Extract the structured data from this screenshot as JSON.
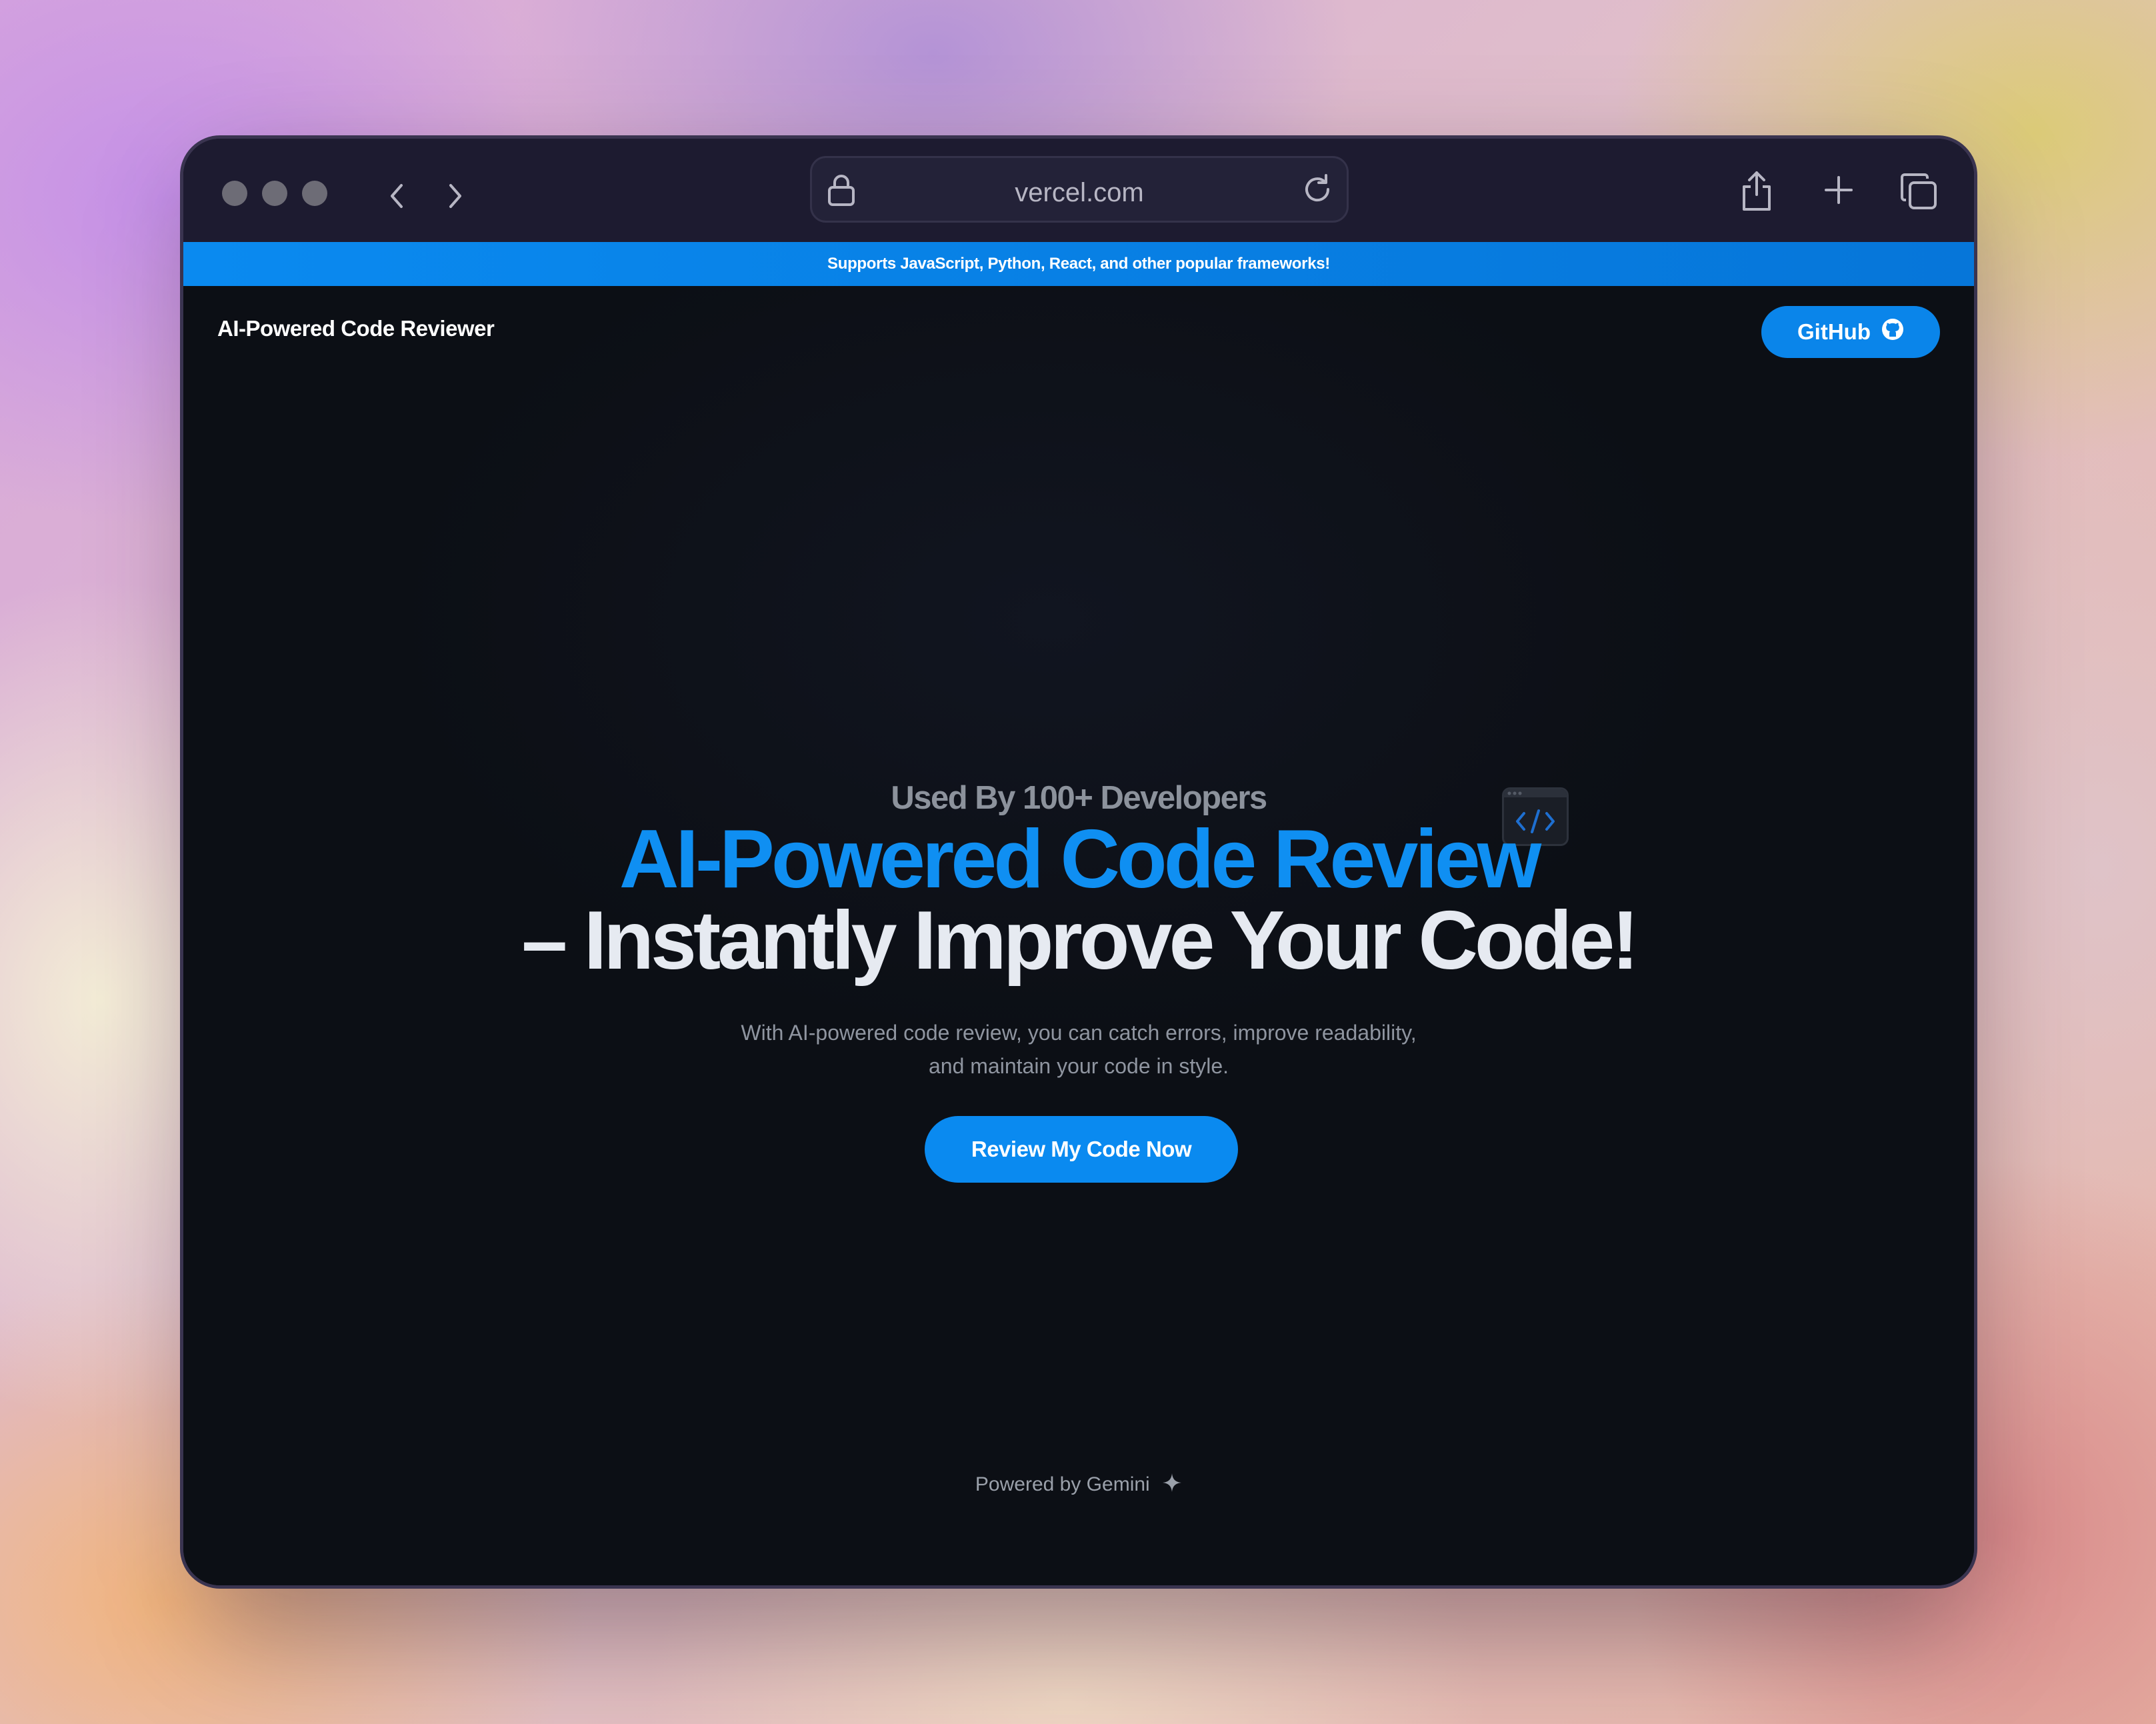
{
  "browser": {
    "url": "vercel.com",
    "icons": [
      "close-dot",
      "minimize-dot",
      "zoom-dot",
      "back-icon",
      "forward-icon",
      "lock-icon",
      "reload-icon",
      "share-icon",
      "new-tab-icon",
      "tabs-overview-icon"
    ]
  },
  "banner": {
    "text": "Supports JavaScript, Python, React, and other popular frameworks!"
  },
  "header": {
    "brand": "AI-Powered Code Reviewer",
    "github_label": "GitHub"
  },
  "hero": {
    "tag": "Used By 100+ Developers",
    "title_line1": "AI-Powered Code Review",
    "title_line2": "– Instantly Improve Your Code!",
    "description_line1": "With AI-powered code review, you can catch errors, improve readability,",
    "description_line2": "and maintain your code in style.",
    "cta_label": "Review My Code Now"
  },
  "footer": {
    "powered_by": "Powered by Gemini"
  },
  "colors": {
    "accent": "#0a8af0",
    "page_background": "#0c0f15",
    "titlebar": "#1d1b30"
  }
}
